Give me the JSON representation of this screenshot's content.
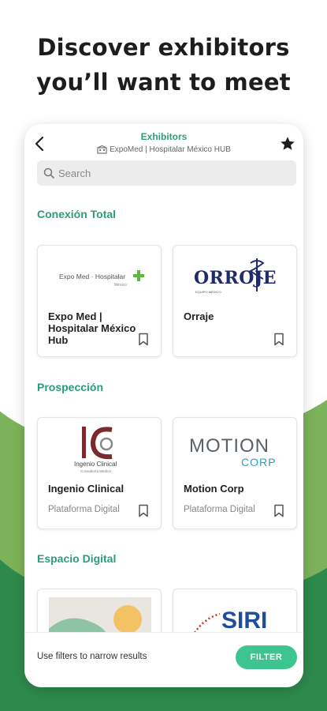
{
  "headline": {
    "line1": "Discover exhibitors",
    "line2": "you’ll want to meet"
  },
  "appbar": {
    "title": "Exhibitors",
    "subtitle": "ExpoMed | Hospitalar México HUB"
  },
  "search": {
    "placeholder": "Search"
  },
  "sections": [
    {
      "title": "Conexión Total",
      "cards": [
        {
          "name": "Expo Med | Hospitalar México Hub",
          "category": "",
          "logo_text": "Expo Med · Hospitalar",
          "logo_subtext": "México"
        },
        {
          "name": "Orraje",
          "category": "",
          "logo_text": "ORROJE",
          "logo_subtext": "EQUIPO MÉDICO"
        }
      ]
    },
    {
      "title": "Prospección",
      "cards": [
        {
          "name": "Ingenio Clinical",
          "category": "Plataforma Digital",
          "logo_text": "Ingenio Clinical",
          "logo_subtext": "Consultoría Médica"
        },
        {
          "name": "Motion Corp",
          "category": "Plataforma Digital",
          "logo_text": "MOTION",
          "logo_subtext": "CORP"
        }
      ]
    },
    {
      "title": "Espacio Digital",
      "cards": [
        {
          "name": "",
          "category": ""
        },
        {
          "name": "",
          "category": "",
          "logo_text": "SIRI"
        }
      ]
    }
  ],
  "bottombar": {
    "hint": "Use filters to narrow results",
    "filter_label": "FILTER"
  },
  "colors": {
    "accent": "#2a9d7c",
    "button": "#3ec48e",
    "green_light": "#7cb35a",
    "green_dark": "#2e8a4c"
  },
  "icons": {
    "back": "chevron-left-icon",
    "favorites": "star-icon",
    "search": "search-icon",
    "venue": "building-icon",
    "bookmark": "bookmark-icon"
  }
}
